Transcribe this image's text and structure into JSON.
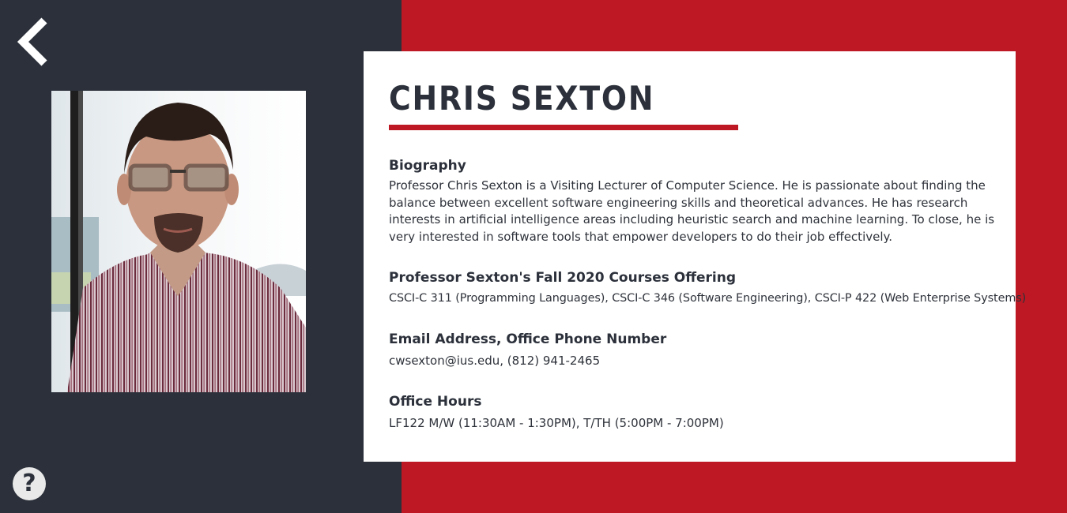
{
  "colors": {
    "dark_panel": "#2b303a",
    "accent_red": "#bd1823",
    "card_background": "#ffffff",
    "heading_text": "#2b303a",
    "body_text": "#2e323a",
    "help_background": "#e9e9e9",
    "back_arrow": "#ffffff"
  },
  "nav": {
    "back_icon": "chevron-left-icon",
    "help_icon": "question-mark-icon",
    "help_label": "?"
  },
  "profile": {
    "photo": "professor-portrait",
    "name": "CHRIS SEXTON"
  },
  "biography": {
    "heading": "Biography",
    "text": "Professor Chris Sexton is a Visiting Lecturer of Computer Science. He is passionate about finding the balance between excellent software engineering skills and theoretical advances. He has research interests in artificial intelligence areas including heuristic search and machine learning. To close, he is very interested in software tools that empower developers to do their job effectively."
  },
  "courses": {
    "heading": "Professor Sexton's Fall 2020 Courses Offering",
    "text": "CSCI-C 311 (Programming Languages), CSCI-C 346 (Software Engineering), CSCI-P 422 (Web Enterprise Systems)"
  },
  "contact": {
    "heading": "Email Address, Office Phone Number",
    "text": "cwsexton@ius.edu, (812) 941-2465"
  },
  "office_hours": {
    "heading": "Office Hours",
    "text": "LF122 M/W (11:30AM - 1:30PM), T/TH (5:00PM - 7:00PM)"
  }
}
